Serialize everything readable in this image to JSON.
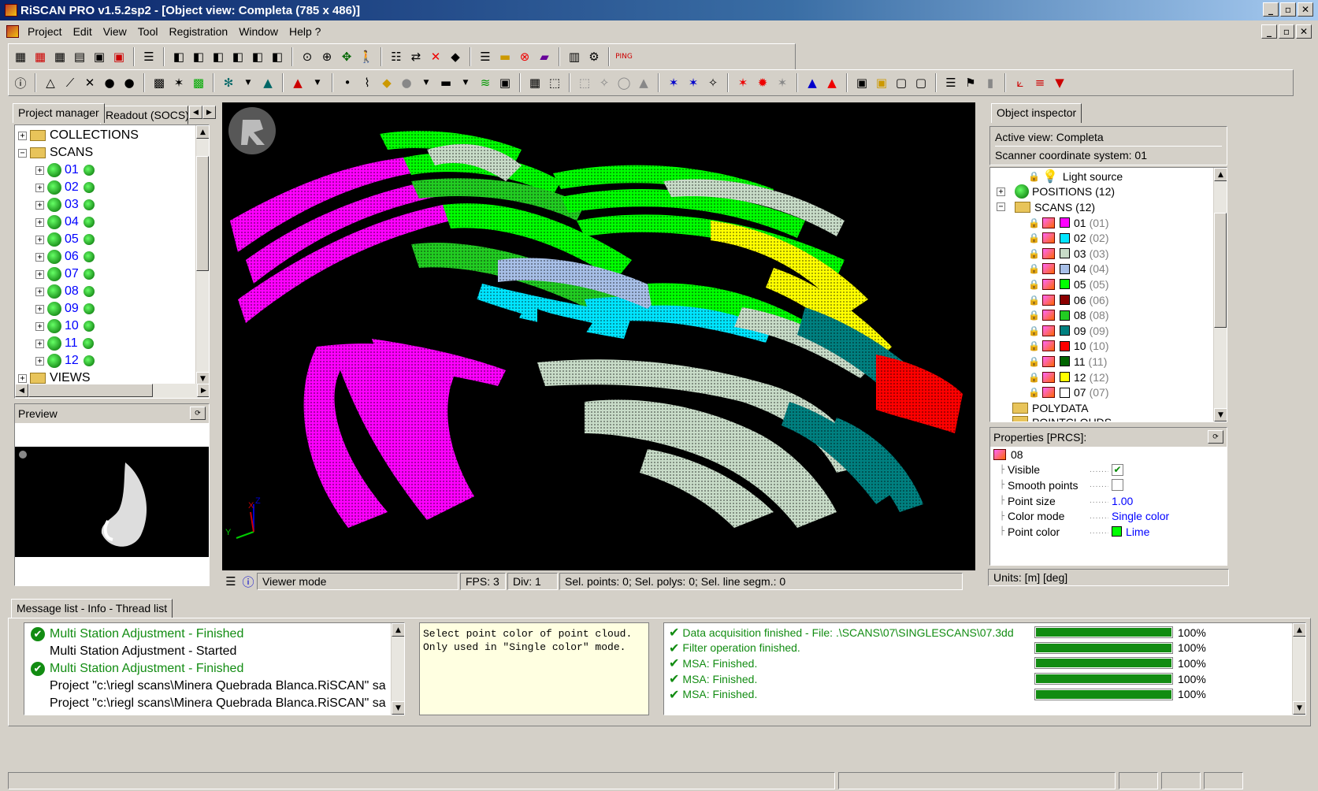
{
  "titlebar": {
    "title": "RiSCAN PRO v1.5.2sp2 - [Object view: Completa (785 x 486)]"
  },
  "menu": [
    "Project",
    "Edit",
    "View",
    "Tool",
    "Registration",
    "Window",
    "Help ?"
  ],
  "left_tabs": {
    "tab1": "Project manager",
    "tab2": "Readout (SOCS)"
  },
  "project_tree": {
    "collections": "COLLECTIONS",
    "scans": "SCANS",
    "scan_items": [
      "01",
      "02",
      "03",
      "04",
      "05",
      "06",
      "07",
      "08",
      "09",
      "10",
      "11",
      "12"
    ],
    "views": "VIEWS"
  },
  "preview": {
    "title": "Preview"
  },
  "viewer_status": {
    "mode": "Viewer mode",
    "fps": "FPS: 3",
    "div": "Div: 1",
    "selection": "Sel. points: 0;  Sel. polys: 0;  Sel. line segm.: 0"
  },
  "axes": {
    "x": "X",
    "y": "Y",
    "z": "Z"
  },
  "object_inspector": {
    "tab": "Object inspector",
    "active_view": "Active view:  Completa",
    "coord_system": "Scanner coordinate system: 01",
    "light_source": "Light source",
    "positions": "POSITIONS (12)",
    "scans": "SCANS (12)",
    "scan_rows": [
      {
        "name": "01",
        "paren": "(01)",
        "color": "#ff00ff"
      },
      {
        "name": "02",
        "paren": "(02)",
        "color": "#00e5ff"
      },
      {
        "name": "03",
        "paren": "(03)",
        "color": "#c8dcc8"
      },
      {
        "name": "04",
        "paren": "(04)",
        "color": "#a8c0e8"
      },
      {
        "name": "05",
        "paren": "(05)",
        "color": "#00ff00"
      },
      {
        "name": "06",
        "paren": "(06)",
        "color": "#8b0000"
      },
      {
        "name": "08",
        "paren": "(08)",
        "color": "#22cc22"
      },
      {
        "name": "09",
        "paren": "(09)",
        "color": "#008080"
      },
      {
        "name": "10",
        "paren": "(10)",
        "color": "#ff0000"
      },
      {
        "name": "11",
        "paren": "(11)",
        "color": "#006400"
      },
      {
        "name": "12",
        "paren": "(12)",
        "color": "#ffff00"
      },
      {
        "name": "07",
        "paren": "(07)",
        "color": "#ffffff"
      }
    ],
    "polydata": "POLYDATA",
    "pointclouds": "POINTCLOUDS"
  },
  "properties": {
    "title": "Properties [PRCS]:",
    "object": "08",
    "rows": [
      {
        "label": "Visible",
        "value": "",
        "type": "check",
        "checked": true
      },
      {
        "label": "Smooth points",
        "value": "",
        "type": "check",
        "checked": false
      },
      {
        "label": "Point size",
        "value": "1.00",
        "type": "text"
      },
      {
        "label": "Color mode",
        "value": "Single color",
        "type": "text"
      },
      {
        "label": "Point color",
        "value": "Lime",
        "type": "color",
        "color": "#00ff00"
      }
    ],
    "units": "Units: [m] [deg]"
  },
  "bottom_tab": "Message list - Info - Thread list",
  "messages": [
    {
      "text": "Multi Station Adjustment - Finished",
      "ok": true
    },
    {
      "text": "Multi Station Adjustment - Started",
      "ok": false
    },
    {
      "text": "Multi Station Adjustment - Finished",
      "ok": true
    },
    {
      "text": "Project \"c:\\riegl scans\\Minera Quebrada Blanca.RiSCAN\" sa",
      "ok": false
    },
    {
      "text": "Project \"c:\\riegl scans\\Minera Quebrada Blanca.RiSCAN\" sa",
      "ok": false
    }
  ],
  "info_text": "Select point color of point cloud. Only used in \"Single color\" mode.",
  "threads": [
    {
      "text": "Data acquisition finished - File: .\\SCANS\\07\\SINGLESCANS\\07.3dd",
      "pct": "100%",
      "progress": 1.0
    },
    {
      "text": "Filter operation finished.",
      "pct": "100%",
      "progress": 1.0
    },
    {
      "text": "MSA: Finished.",
      "pct": "100%",
      "progress": 1.0
    },
    {
      "text": "MSA: Finished.",
      "pct": "100%",
      "progress": 1.0
    },
    {
      "text": "MSA: Finished.",
      "pct": "100%",
      "progress": 1.0
    }
  ]
}
